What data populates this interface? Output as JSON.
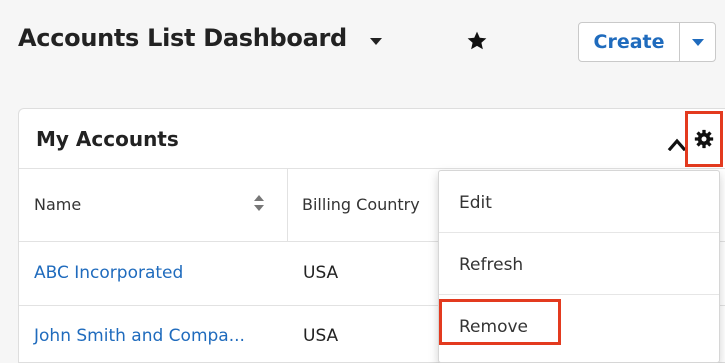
{
  "header": {
    "title": "Accounts List Dashboard",
    "create_label": "Create"
  },
  "dashlet": {
    "title": "My Accounts",
    "columns": [
      "Name",
      "Billing Country"
    ],
    "rows": [
      {
        "name": "ABC Incorporated",
        "country": "USA"
      },
      {
        "name": "John Smith and Compa...",
        "country": "USA"
      }
    ]
  },
  "menu": {
    "items": [
      "Edit",
      "Refresh",
      "Remove"
    ]
  },
  "icons": {
    "title_dropdown": "chevron-down-icon",
    "favorite": "star-icon",
    "create_dropdown": "chevron-down-icon",
    "collapse": "chevron-up-icon",
    "settings": "gear-icon",
    "sort": "sort-icon"
  },
  "colors": {
    "link": "#1f6bbd",
    "highlight": "#e33a1f",
    "background": "#f6f6f6"
  }
}
